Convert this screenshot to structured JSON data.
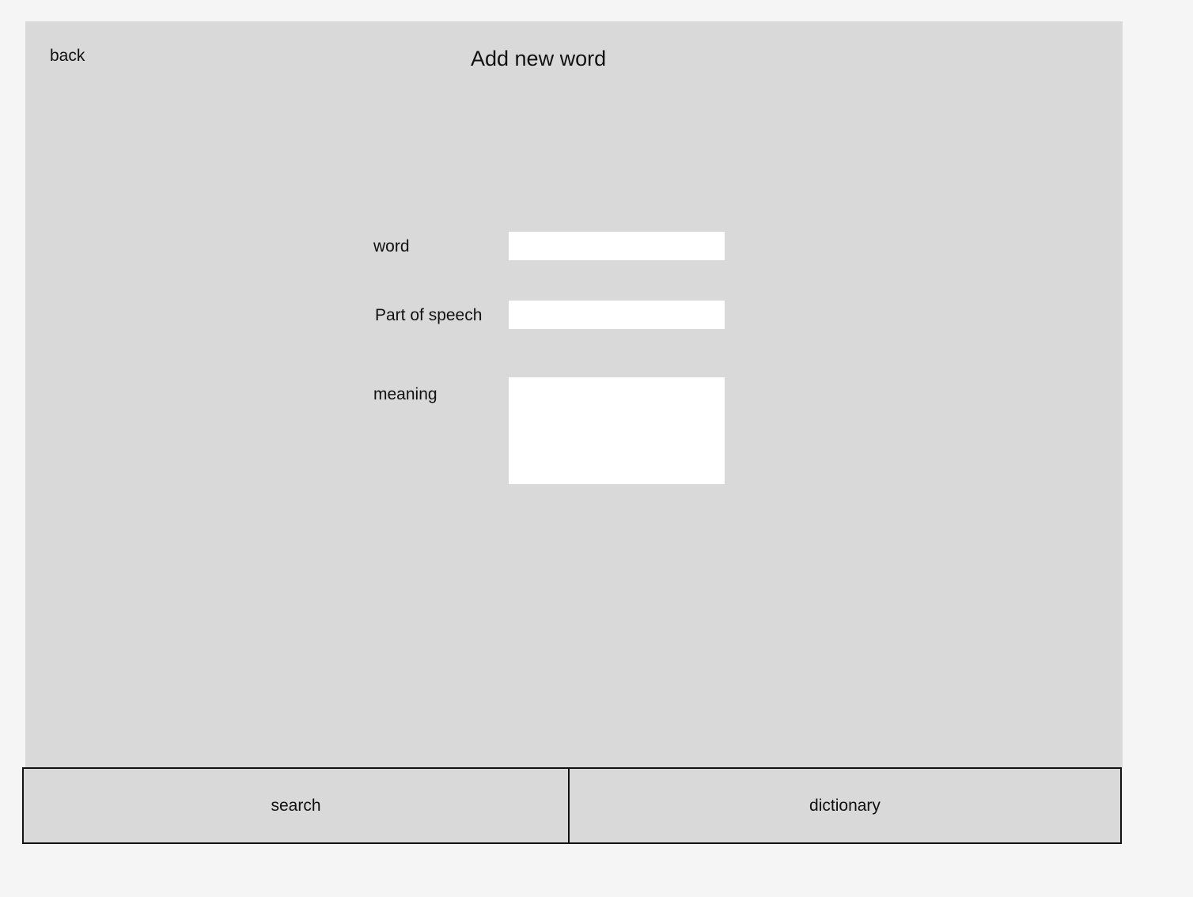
{
  "header": {
    "back_label": "back",
    "title": "Add new word"
  },
  "form": {
    "word_label": "word",
    "word_value": "",
    "part_of_speech_label": "Part of speech",
    "part_of_speech_value": "",
    "meaning_label": "meaning",
    "meaning_value": ""
  },
  "bottom_nav": {
    "tabs": [
      {
        "label": "search"
      },
      {
        "label": "dictionary"
      }
    ]
  },
  "colors": {
    "page_background": "#f5f5f5",
    "frame_background": "#d9d9d9",
    "input_background": "#ffffff",
    "border": "#111111"
  }
}
